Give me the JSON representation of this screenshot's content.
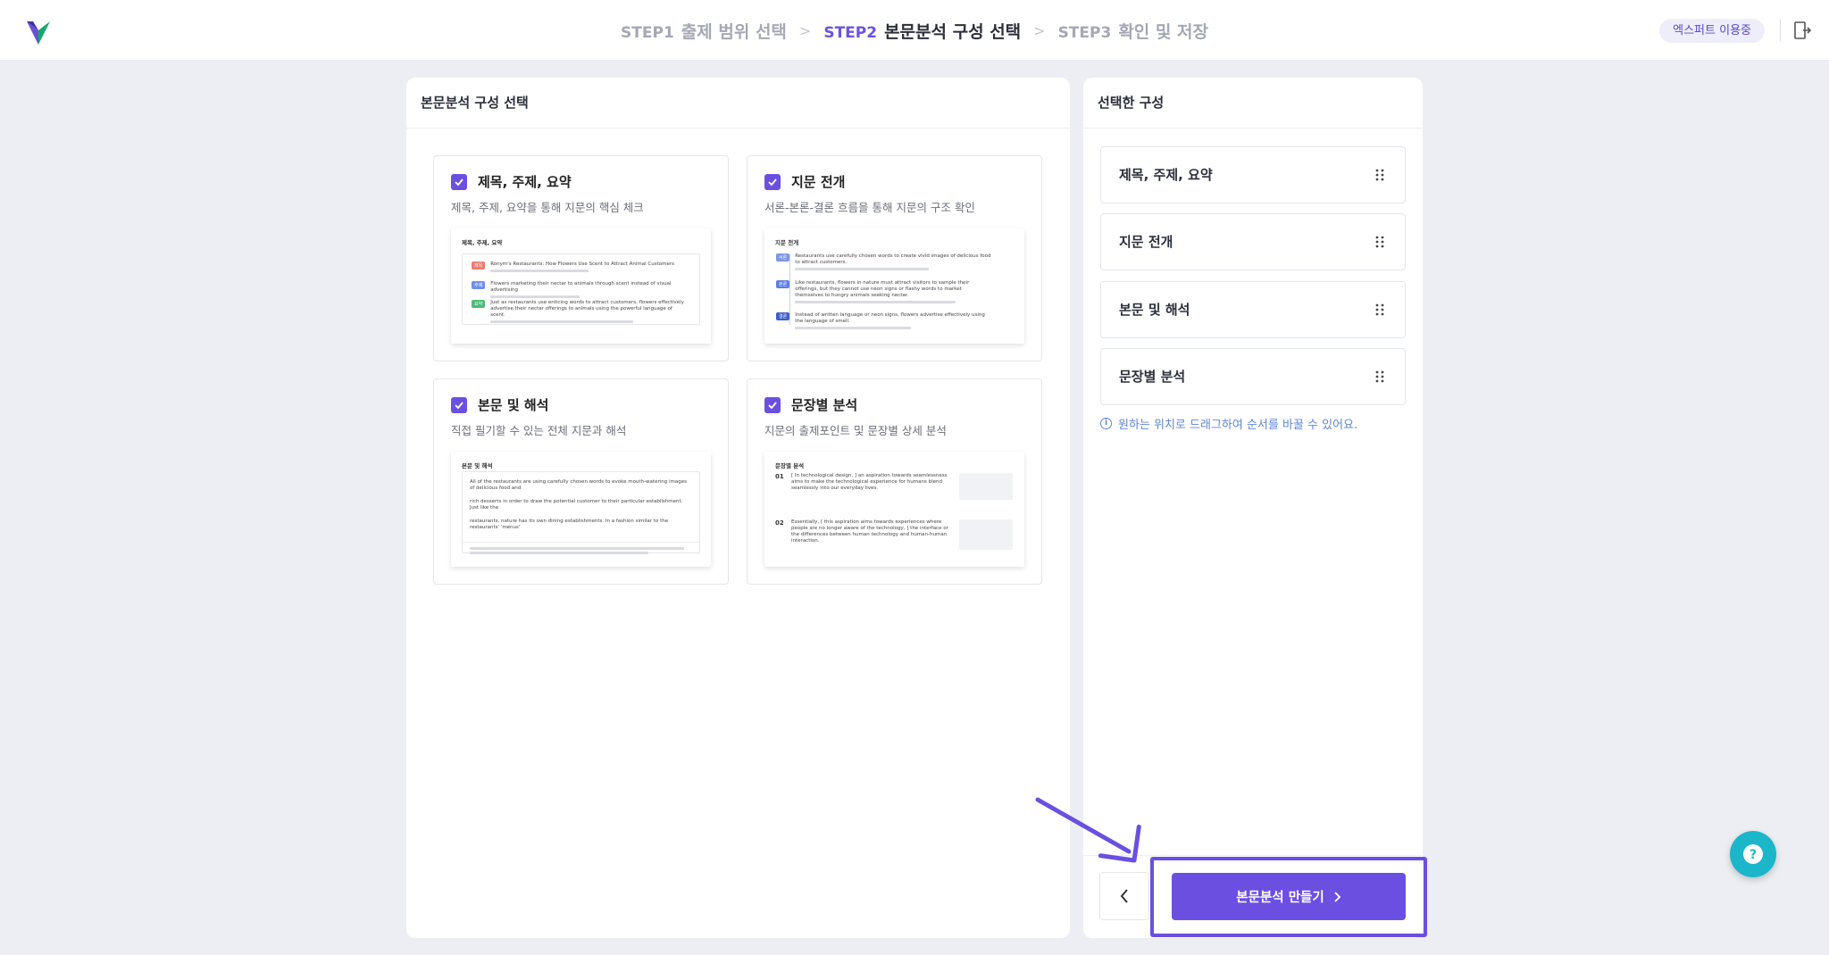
{
  "header": {
    "steps": [
      {
        "num": "STEP1",
        "label": "출제 범위 선택"
      },
      {
        "num": "STEP2",
        "label": "본문분석 구성 선택"
      },
      {
        "num": "STEP3",
        "label": "확인 및 저장"
      }
    ],
    "expert_badge": "엑스퍼트 이용중"
  },
  "left_panel": {
    "title": "본문분석 구성 선택",
    "cards": [
      {
        "title": "제목, 주제, 요약",
        "desc": "제목, 주제, 요약을 통해 지문의 핵심 체크",
        "checked": true
      },
      {
        "title": "지문 전개",
        "desc": "서론-본론-결론 흐름을 통해 지문의 구조 확인",
        "checked": true
      },
      {
        "title": "본문 및 해석",
        "desc": "직접 필기할 수 있는 전체 지문과 해석",
        "checked": true
      },
      {
        "title": "문장별 분석",
        "desc": "지문의 출제포인트 및 문장별 상세 분석",
        "checked": true
      }
    ],
    "previews": {
      "p1": {
        "title": "제목, 주제, 요약",
        "rows": [
          {
            "tag": "제목",
            "text": "Ronym's Restaurants: How Flowers Use Scent to Attract Animal Customers"
          },
          {
            "tag": "주제",
            "text": "Flowers marketing their nectar to animals through scent instead of visual advertising"
          },
          {
            "tag": "요약",
            "text": "Just as restaurants use enticing words to attract customers, flowers effectively advertise their nectar offerings to animals using the powerful language of scent."
          }
        ]
      },
      "p2": {
        "title": "지문 전개",
        "rows": [
          {
            "tag": "서론",
            "text": "Restaurants use carefully chosen words to create vivid images of delicious food to attract customers."
          },
          {
            "tag": "본론",
            "text": "Like restaurants, flowers in nature must attract visitors to sample their offerings, but they cannot use neon signs or flashy words to market themselves to hungry animals seeking nectar."
          },
          {
            "tag": "결론",
            "text": "Instead of written language or neon signs, flowers advertise effectively using the language of smell."
          }
        ]
      },
      "p3": {
        "title": "본문 및 해석",
        "lines": [
          "All of the restaurants are using carefully chosen words to evoke mouth-watering images of delicious food and",
          "rich desserts in order to draw the potential customer to their particular establishment.  Just like the",
          "restaurants, nature has its own dining establishments.  In a fashion similar to the restaurants' 'menus'"
        ]
      },
      "p4": {
        "title": "문장별 분석",
        "items": [
          {
            "num": "01",
            "text": "[ In technological design, ] an aspiration towards seamlessness aims to make the technological experience for humans blend seamlessly into our everyday lives."
          },
          {
            "num": "02",
            "text": "Essentially, [ this aspiration aims towards experiences where people are no longer aware of the technology, ] the interface or the differences between human technology and human-human interaction."
          }
        ]
      }
    }
  },
  "right_panel": {
    "title": "선택한 구성",
    "items": [
      "제목, 주제, 요약",
      "지문 전개",
      "본문 및 해석",
      "문장별 분석"
    ],
    "hint": "원하는 위치로 드래그하여 순서를 바꿀 수 있어요.",
    "create_button": "본문분석 만들기"
  },
  "colors": {
    "accent": "#6b4fe0",
    "hint": "#5f86d4",
    "help_fab": "#1bb6c9"
  },
  "icons": [
    "logo-icon",
    "exit-icon",
    "check-icon",
    "drag-handle-icon",
    "info-icon",
    "chevron-left-icon",
    "chevron-right-icon",
    "help-chat-icon"
  ]
}
